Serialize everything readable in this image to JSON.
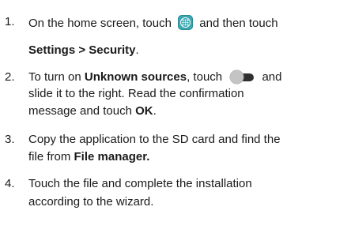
{
  "steps": [
    {
      "number": "1.",
      "line1_a": "On the home screen, touch",
      "icon1": "apps-grid-icon",
      "line1_b": "and then touch",
      "line2_bold": "Settings > Security",
      "line2_end": "."
    },
    {
      "number": "2.",
      "line1_a": "To turn on ",
      "line1_bold": "Unknown sources",
      "line1_b": ", touch",
      "icon1": "toggle-switch-icon",
      "line1_c": "and",
      "line2": "slide it to the right. Read the confirmation",
      "line3_a": "message and touch ",
      "line3_bold": "OK",
      "line3_end": "."
    },
    {
      "number": "3.",
      "line1": "Copy the application to the SD card and find the",
      "line2_a": "file from ",
      "line2_bold": "File manager."
    },
    {
      "number": "4.",
      "line1": "Touch the file and complete the installation",
      "line2": "according to the wizard."
    }
  ],
  "colors": {
    "text": "#1a1a1a",
    "apps_icon": "#3aa7b1",
    "toggle_track": "#303030",
    "toggle_knob": "#c4c4c4"
  }
}
